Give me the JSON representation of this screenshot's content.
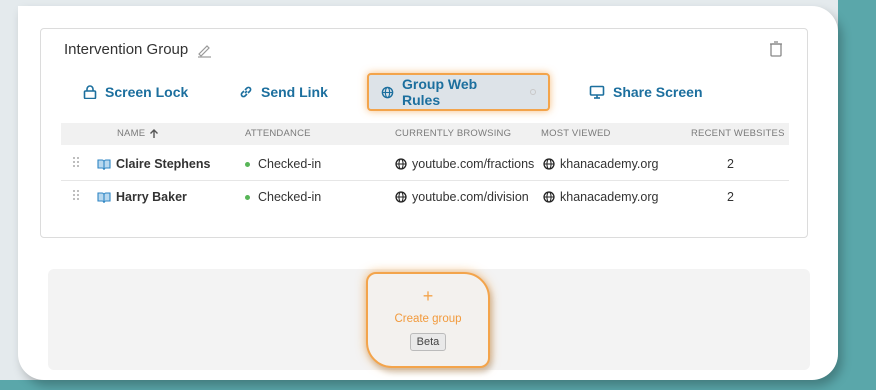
{
  "group": {
    "title": "Intervention Group"
  },
  "toolbar": {
    "screen_lock": "Screen Lock",
    "send_link": "Send Link",
    "group_web_rules": "Group Web Rules",
    "share_screen": "Share Screen"
  },
  "table": {
    "headers": {
      "name": "NAME",
      "attendance": "ATTENDANCE",
      "browsing": "CURRENTLY BROWSING",
      "most_viewed": "MOST VIEWED",
      "recent": "RECENT WEBSITES"
    },
    "rows": [
      {
        "name": "Claire Stephens",
        "attendance": "Checked-in",
        "browsing": "youtube.com/fractions",
        "most_viewed": "khanacademy.org",
        "recent": "2"
      },
      {
        "name": "Harry Baker",
        "attendance": "Checked-in",
        "browsing": "youtube.com/division",
        "most_viewed": "khanacademy.org",
        "recent": "2"
      }
    ]
  },
  "create": {
    "label": "Create group",
    "badge": "Beta"
  },
  "colors": {
    "accent": "#1c6f9e",
    "highlight": "#f3a44b",
    "checked_in": "#57b557",
    "background": "#5aa7aa"
  },
  "icons": [
    "pencil-icon",
    "trash-icon",
    "lock-icon",
    "link-icon",
    "globe-icon",
    "monitor-icon",
    "arrow-up-icon",
    "drag-handle-icon",
    "book-icon",
    "plus-icon"
  ]
}
